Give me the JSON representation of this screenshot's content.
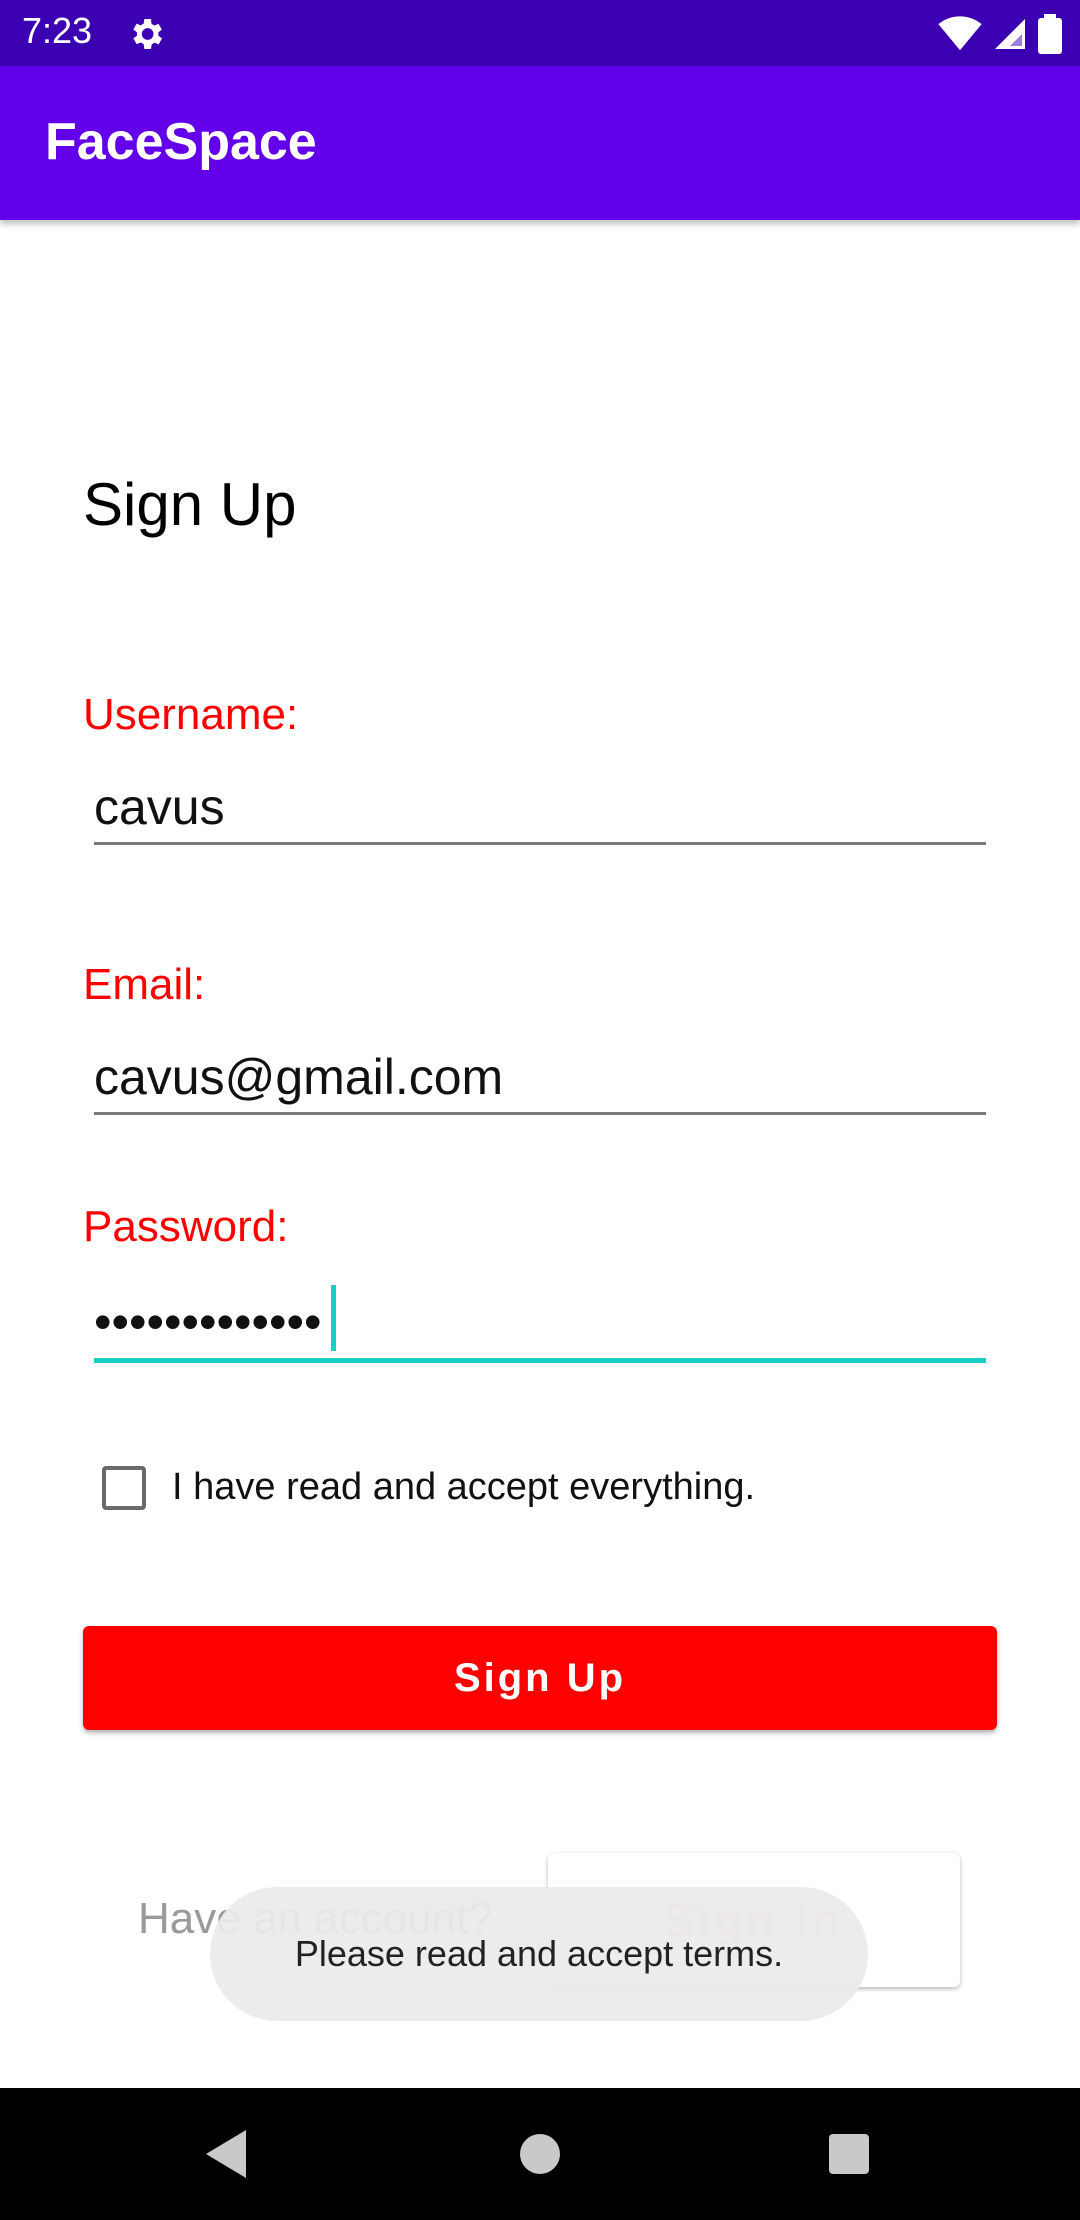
{
  "status_bar": {
    "time": "7:23",
    "icons": [
      "gear-icon",
      "wifi-icon",
      "signal-icon",
      "battery-icon"
    ]
  },
  "app_bar": {
    "title": "FaceSpace"
  },
  "form": {
    "title": "Sign Up",
    "username": {
      "label": "Username:",
      "value": "cavus"
    },
    "email": {
      "label": "Email:",
      "value": "cavus@gmail.com"
    },
    "password": {
      "label": "Password:",
      "value": "•••••••••••••"
    },
    "terms_checkbox": {
      "label": "I have read and accept everything.",
      "checked": false
    },
    "signup_button": "Sign Up",
    "have_account_text": "Have an account?",
    "signin_button": "Sign In"
  },
  "toast": {
    "message": "Please read and accept terms."
  },
  "colors": {
    "status_bar": "#3c00b3",
    "app_bar": "#6200ea",
    "label": "#ff0000",
    "primary_button": "#ff0000",
    "focus_underline": "#17d0c4"
  },
  "nav_bar": {
    "buttons": [
      "back-icon",
      "home-icon",
      "recents-icon"
    ]
  }
}
